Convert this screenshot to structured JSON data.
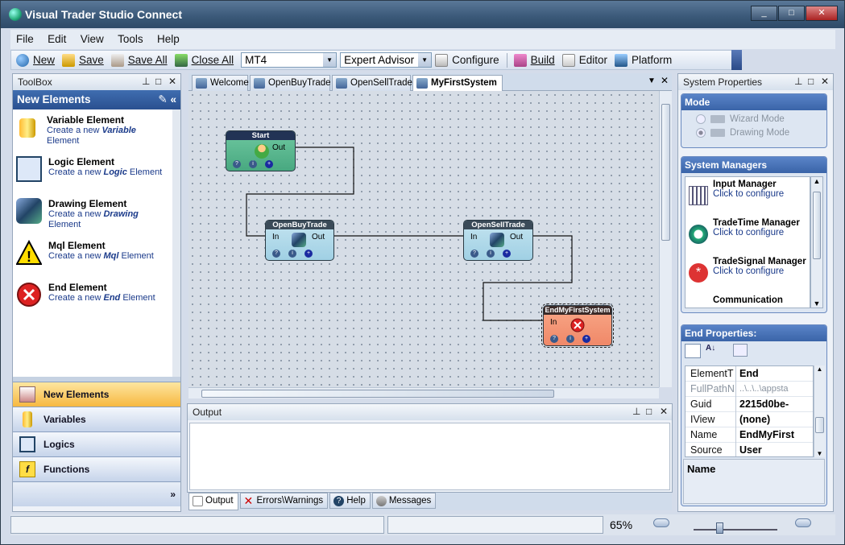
{
  "window": {
    "title": "Visual Trader Studio Connect",
    "buttons": {
      "minimize": "_",
      "maximize": "□",
      "close": "✕"
    }
  },
  "menu": [
    "File",
    "Edit",
    "View",
    "Tools",
    "Help"
  ],
  "toolbar": {
    "new": "New",
    "save": "Save",
    "save_all": "Save All",
    "close_all": "Close All",
    "platform_combo": "MT4",
    "advisor_combo": "Expert Advisor",
    "configure": "Configure",
    "build": "Build",
    "editor": "Editor",
    "platform": "Platform"
  },
  "toolbox": {
    "title": "ToolBox",
    "section_title": "New Elements",
    "items": [
      {
        "title": "Variable Element",
        "pre": "Create a new ",
        "em": "Variable",
        "post": " Element"
      },
      {
        "title": "Logic Element",
        "pre": "Create a new ",
        "em": "Logic",
        "post": " Element"
      },
      {
        "title": "Drawing Element",
        "pre": "Create a new ",
        "em": "Drawing",
        "post": " Element"
      },
      {
        "title": "Mql Element",
        "pre": "Create a new ",
        "em": "Mql",
        "post": " Element"
      },
      {
        "title": "End Element",
        "pre": "Create a new ",
        "em": "End",
        "post": " Element"
      }
    ],
    "nav": [
      "New Elements",
      "Variables",
      "Logics",
      "Functions"
    ],
    "more": "»"
  },
  "tabs": [
    "Welcome",
    "OpenBuyTrade",
    "OpenSellTrade",
    "MyFirstSystem"
  ],
  "diagram": {
    "nodes": {
      "start": {
        "title": "Start",
        "out": "Out"
      },
      "buy": {
        "title": "OpenBuyTrade",
        "in": "In",
        "out": "Out"
      },
      "sell": {
        "title": "OpenSellTrade",
        "in": "In",
        "out": "Out"
      },
      "end": {
        "title": "EndMyFirstSystem",
        "in": "In"
      }
    },
    "btn_labels": {
      "help": "?",
      "info": "i",
      "add": "+"
    }
  },
  "output": {
    "title": "Output",
    "tabs": [
      "Output",
      "Errors\\Warnings",
      "Help",
      "Messages"
    ]
  },
  "system_properties": {
    "title": "System Properties",
    "mode": {
      "title": "Mode",
      "options": [
        "Wizard Mode",
        "Drawing Mode"
      ]
    },
    "managers": {
      "title": "System Managers",
      "items": [
        {
          "title": "Input Manager",
          "desc": "Click to configure"
        },
        {
          "title": "TradeTime Manager",
          "desc": "Click to configure"
        },
        {
          "title": "TradeSignal Manager",
          "desc": "Click to configure"
        },
        {
          "title": "Communication",
          "desc": ""
        }
      ]
    },
    "end_props": {
      "title": "End Properties:",
      "rows": [
        {
          "k": "ElementT",
          "v": "End"
        },
        {
          "k": "FullPathN",
          "v": "..\\..\\..\\appsta"
        },
        {
          "k": "Guid",
          "v": "2215d0be-"
        },
        {
          "k": "IView",
          "v": "(none)"
        },
        {
          "k": "Name",
          "v": "EndMyFirst"
        },
        {
          "k": "Source",
          "v": "User"
        }
      ],
      "desc_title": "Name"
    }
  },
  "status": {
    "zoom": "65%"
  }
}
